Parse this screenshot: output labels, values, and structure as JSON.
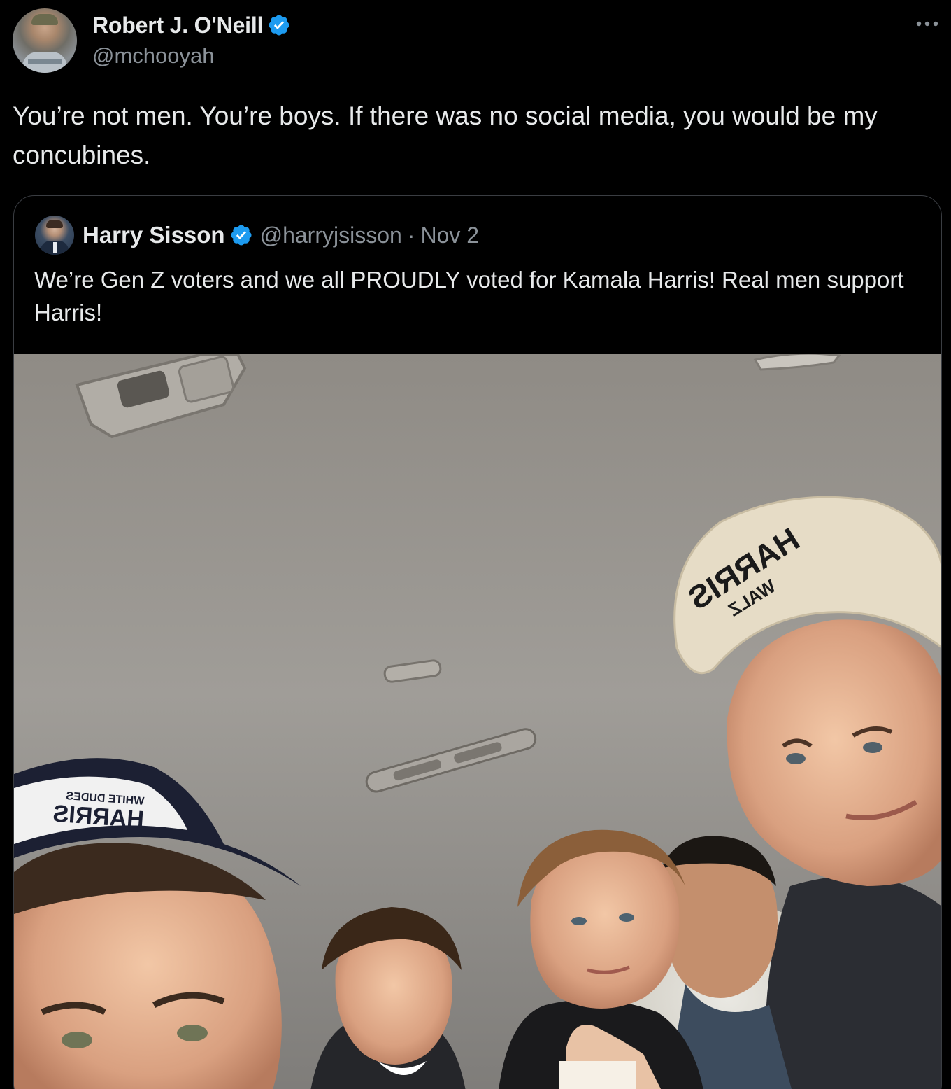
{
  "author": {
    "display_name": "Robert J. O'Neill",
    "handle": "@mchooyah",
    "verified": true
  },
  "tweet": {
    "text": "You’re not men. You’re boys. If there was no social media, you would be my concubines."
  },
  "quoted_tweet": {
    "display_name": "Harry Sisson",
    "handle": "@harryjsisson",
    "separator": "·",
    "date": "Nov 2",
    "verified": true,
    "text": "We’re Gen Z voters and we all PROUDLY voted for Kamala Harris! Real men support Harris!"
  },
  "media": {
    "cap_right": {
      "line1": "HARRIS",
      "line2": "WALZ"
    },
    "cap_left": {
      "small": "WHITE DUDES",
      "large": "HARRIS"
    }
  },
  "colors": {
    "background": "#000000",
    "text_primary": "#e7e9ea",
    "text_secondary": "#8b9299",
    "verified_blue": "#1d9bf0",
    "border": "#3a3d42"
  }
}
